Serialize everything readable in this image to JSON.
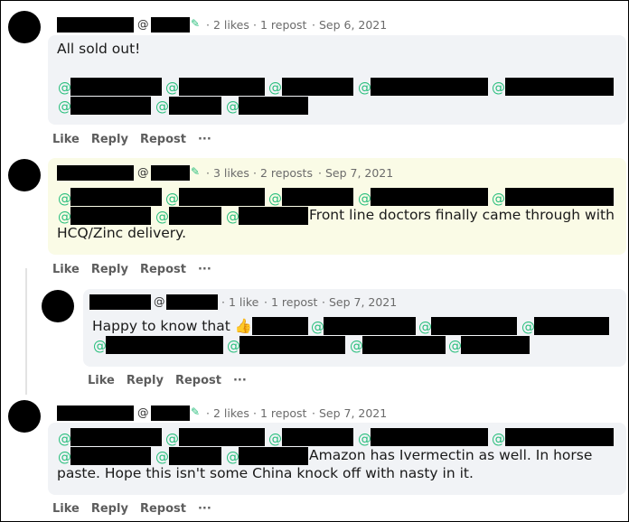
{
  "comments": [
    {
      "at": "@",
      "likes": "2 likes",
      "reposts": "1 repost",
      "date": "Sep 6, 2021",
      "text": "All sold out!",
      "highlighted": false
    },
    {
      "at": "@",
      "likes": "3 likes",
      "reposts": "2 reposts",
      "date": "Sep 7, 2021",
      "text_line1": "Front line doctors finally came through with",
      "text_line2": "HCQ/Zinc delivery.",
      "highlighted": true
    },
    {
      "at": "@",
      "likes": "1 like",
      "reposts": "1 repost",
      "date": "Sep 7, 2021",
      "text": "Happy to know that 👍",
      "highlighted": false
    },
    {
      "at": "@",
      "likes": "2 likes",
      "reposts": "1 repost",
      "date": "Sep 7, 2021",
      "text_line1": "Amazon has Ivermectin as well. In horse",
      "text_line2": "paste. Hope this isn't some China knock off with nasty in it.",
      "highlighted": false
    }
  ],
  "actions": {
    "like": "Like",
    "reply": "Reply",
    "repost": "Repost",
    "more": "···"
  },
  "sep": "·",
  "colors": {
    "bubble": "#f1f3f6",
    "highlight": "#fafbe6",
    "mention": "#2bbf7e",
    "meta": "#6b6b6b"
  },
  "icons": {
    "pin": "pin-icon"
  }
}
